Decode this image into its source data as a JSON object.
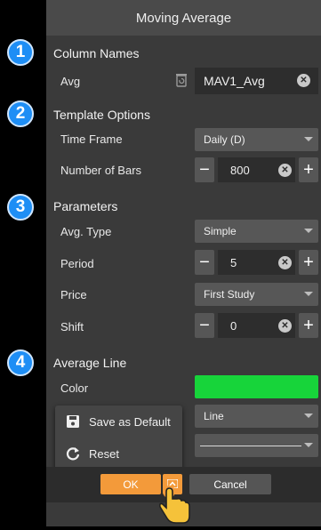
{
  "dialog": {
    "title": "Moving Average"
  },
  "badges": [
    "1",
    "2",
    "3",
    "4"
  ],
  "column_names": {
    "section": "Column Names",
    "label": "Avg",
    "value": "MAV1_Avg"
  },
  "template_options": {
    "section": "Template Options",
    "time_frame_label": "Time Frame",
    "time_frame_value": "Daily (D)",
    "bars_label": "Number of Bars",
    "bars_value": "800"
  },
  "parameters": {
    "section": "Parameters",
    "avg_type_label": "Avg. Type",
    "avg_type_value": "Simple",
    "period_label": "Period",
    "period_value": "5",
    "price_label": "Price",
    "price_value": "First Study",
    "shift_label": "Shift",
    "shift_value": "0"
  },
  "average_line": {
    "section": "Average Line",
    "color_label": "Color",
    "color_value": "#17d43a",
    "style_value": "Line"
  },
  "menu": {
    "save_default": "Save as Default",
    "reset": "Reset"
  },
  "footer": {
    "ok": "OK",
    "cancel": "Cancel"
  },
  "colors": {
    "accent": "#f39a3a",
    "badge": "#1e8ef5",
    "panel": "#3a3a3a"
  }
}
